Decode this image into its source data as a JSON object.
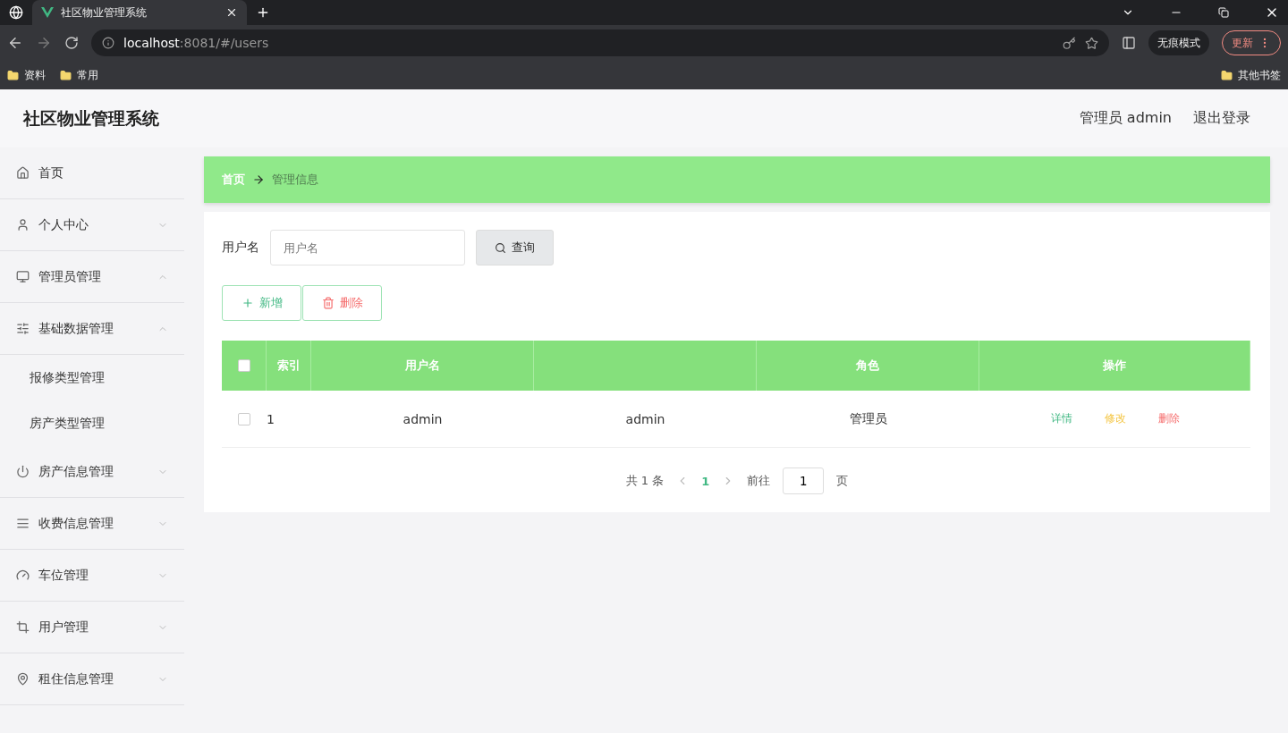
{
  "browser": {
    "tab_title": "社区物业管理系统",
    "url_host": "localhost",
    "url_path": ":8081/#/users",
    "incognito_label": "无痕模式",
    "update_label": "更新",
    "bookmarks": [
      "资料",
      "常用"
    ],
    "other_bookmarks": "其他书签"
  },
  "header": {
    "title": "社区物业管理系统",
    "user": "管理员 admin",
    "logout": "退出登录"
  },
  "sidebar": {
    "items": [
      {
        "label": "首页",
        "selected": false
      },
      {
        "label": "个人中心",
        "expanded": false,
        "selected": false
      },
      {
        "label": "管理员管理",
        "expanded": true,
        "selected": false
      },
      {
        "label": "基础数据管理",
        "expanded": true,
        "selected": false,
        "children": [
          {
            "label": "报修类型管理",
            "selected": false
          },
          {
            "label": "房产类型管理",
            "selected": false
          }
        ]
      },
      {
        "label": "房产信息管理",
        "expanded": false,
        "selected": false
      },
      {
        "label": "收费信息管理",
        "expanded": false,
        "selected": false
      },
      {
        "label": "车位管理",
        "expanded": false,
        "selected": false
      },
      {
        "label": "用户管理",
        "expanded": false,
        "selected": false
      },
      {
        "label": "租住信息管理",
        "expanded": false,
        "selected": false
      }
    ]
  },
  "breadcrumb": [
    "首页",
    "管理信息"
  ],
  "search": {
    "label": "用户名",
    "placeholder": "用户名",
    "button": "查询"
  },
  "actions": [
    {
      "label": "新增",
      "kind": "add"
    },
    {
      "label": "删除",
      "kind": "delete"
    }
  ],
  "table": {
    "select_all_checked": false,
    "columns": [
      "索引",
      "用户名",
      "",
      "角色",
      "操作"
    ],
    "rows": [
      {
        "checked": false,
        "cells": [
          "1",
          "admin",
          "admin",
          "管理员"
        ],
        "links": [
          {
            "label": "详情",
            "kind": "detail"
          },
          {
            "label": "修改",
            "kind": "edit"
          },
          {
            "label": "删除",
            "kind": "delete"
          }
        ]
      }
    ]
  },
  "pagination": {
    "total": "共 1 条",
    "pages": [
      {
        "label": "1",
        "selected": true
      }
    ],
    "goto_label": "前往",
    "goto_value": "1",
    "goto_suffix": "页"
  }
}
